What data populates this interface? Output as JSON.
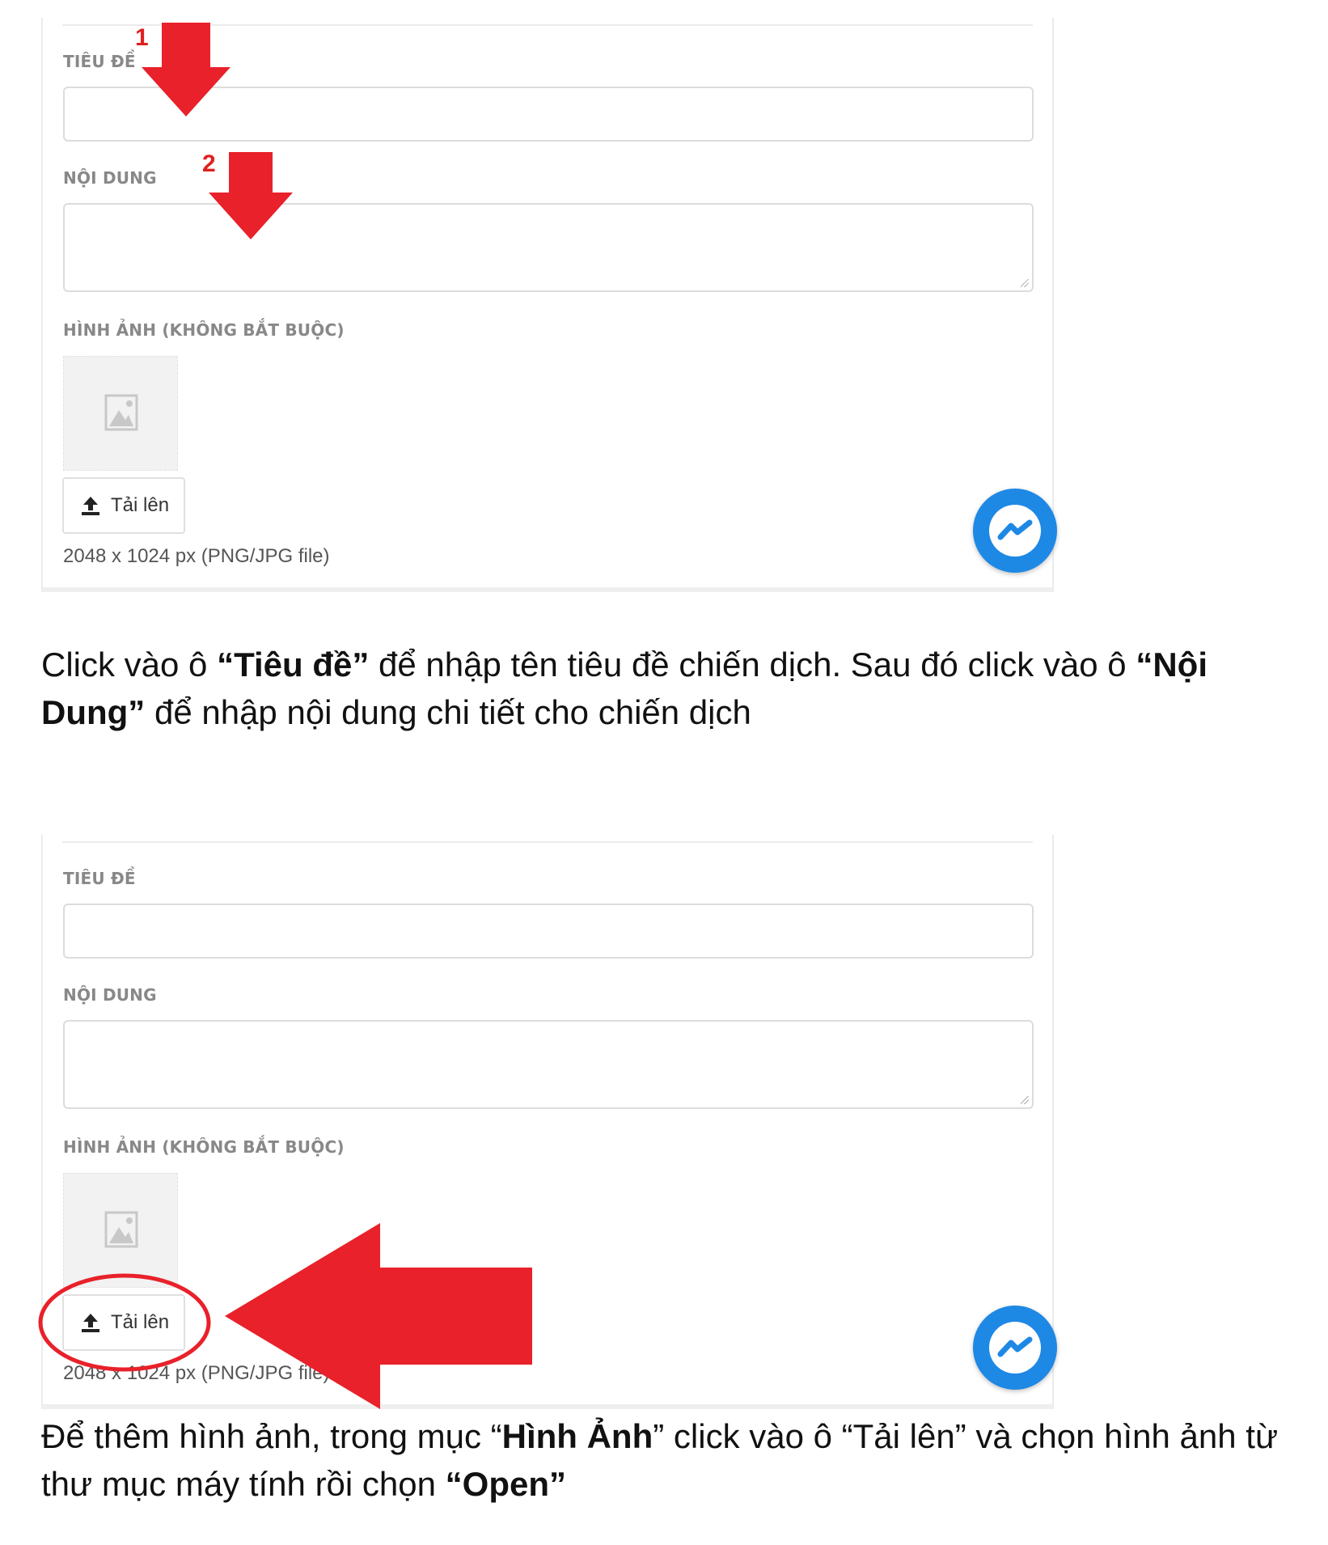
{
  "form": {
    "title_label": "TIÊU ĐỀ",
    "content_label": "NỘI DUNG",
    "image_label": "HÌNH ẢNH (KHÔNG BẮT BUỘC)",
    "upload_label": "Tải lên",
    "image_hint": "2048 x 1024 px (PNG/JPG file)"
  },
  "annotations": {
    "step1": "1",
    "step2": "2"
  },
  "instruction1": {
    "t1": "Click vào ô ",
    "b1": "“Tiêu đề”",
    "t2": " để nhập tên tiêu đề chiến dịch. Sau đó click vào ô ",
    "b2": "“Nội Dung”",
    "t3": " để nhập nội dung chi tiết cho chiến dịch"
  },
  "instruction2": {
    "t1": "Để thêm hình ảnh, trong mục “",
    "b1": "Hình Ảnh",
    "t2": "” click vào ô “Tải lên” và chọn hình ảnh từ thư mục máy tính rồi chọn ",
    "b2": "“Open”"
  },
  "colors": {
    "annotation_red": "#e8212a",
    "messenger_blue": "#1e88e5",
    "label_gray": "#888888"
  },
  "icons": [
    "upload-icon",
    "image-placeholder-icon",
    "messenger-icon",
    "arrow-down-icon",
    "arrow-left-icon"
  ]
}
